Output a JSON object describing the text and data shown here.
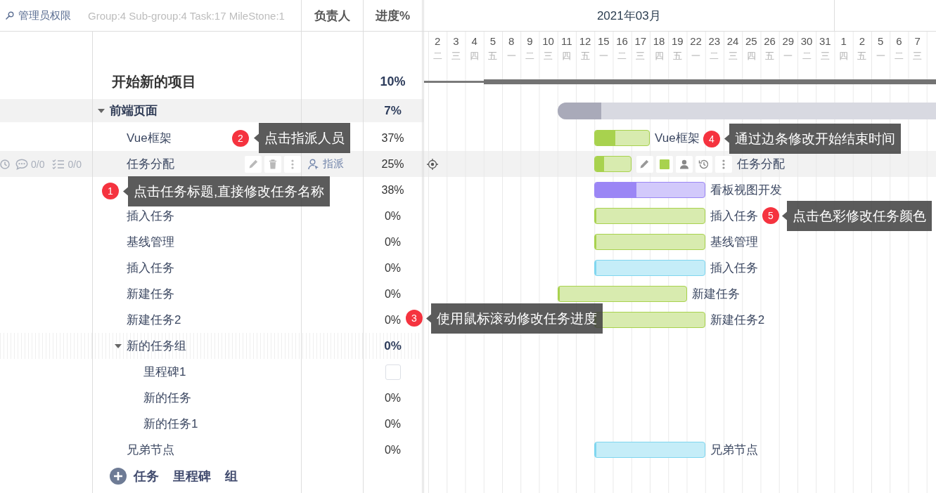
{
  "toolbar": {
    "role_link": "管理员权限",
    "summary": "Group:4 Sub-group:4 Task:17 MileStone:1"
  },
  "columns": [
    {
      "label": "负责人"
    },
    {
      "label": "进度%"
    }
  ],
  "timeline": {
    "months": [
      {
        "label": "2021年03月",
        "days": [
          {
            "day": "2",
            "weekday": "二"
          },
          {
            "day": "3",
            "weekday": "三"
          },
          {
            "day": "4",
            "weekday": "四"
          },
          {
            "day": "5",
            "weekday": "五"
          },
          {
            "day": "8",
            "weekday": "一"
          },
          {
            "day": "9",
            "weekday": "二"
          },
          {
            "day": "10",
            "weekday": "三"
          },
          {
            "day": "11",
            "weekday": "四"
          },
          {
            "day": "12",
            "weekday": "五"
          },
          {
            "day": "15",
            "weekday": "一"
          },
          {
            "day": "16",
            "weekday": "二"
          },
          {
            "day": "17",
            "weekday": "三"
          },
          {
            "day": "18",
            "weekday": "四"
          },
          {
            "day": "19",
            "weekday": "五"
          },
          {
            "day": "22",
            "weekday": "一"
          },
          {
            "day": "23",
            "weekday": "二"
          },
          {
            "day": "24",
            "weekday": "三"
          },
          {
            "day": "25",
            "weekday": "四"
          },
          {
            "day": "26",
            "weekday": "五"
          },
          {
            "day": "29",
            "weekday": "一"
          },
          {
            "day": "30",
            "weekday": "二"
          },
          {
            "day": "31",
            "weekday": "三"
          }
        ]
      },
      {
        "days": [
          {
            "day": "1",
            "weekday": "四"
          },
          {
            "day": "2",
            "weekday": "五"
          },
          {
            "day": "5",
            "weekday": "一"
          },
          {
            "day": "6",
            "weekday": "二"
          },
          {
            "day": "7",
            "weekday": "三"
          }
        ]
      }
    ]
  },
  "tasks": [
    {
      "kind": "project",
      "name": "开始新的项目",
      "progress": "10%",
      "hovered": false,
      "children": [
        {
          "kind": "group",
          "name": "前端页面",
          "progress": "7%",
          "expanded": true,
          "hovered": false,
          "bar": {
            "level": 0.07
          },
          "children": [
            {
              "kind": "task",
              "name": "Vue框架",
              "progress": "37%",
              "hovered": false,
              "bar": {
                "level": 0.37,
                "color": "#a8d24e",
                "label": "Vue框架"
              }
            },
            {
              "kind": "task",
              "name": "任务分配",
              "progress": "25%",
              "hovered": true,
              "comments": "0/0",
              "checklist": "0/0",
              "assign_action": "指派",
              "bar": {
                "level": 0.25,
                "color": "#a8d24e",
                "label": "任务分配"
              }
            },
            {
              "kind": "task",
              "progress": "38%",
              "hovered": false,
              "bar": {
                "level": 0.38,
                "color": "#9b86f5",
                "label": "看板视图开发"
              }
            },
            {
              "kind": "task",
              "name": "插入任务",
              "progress": "0%",
              "hovered": false,
              "bar": {
                "level": 0,
                "color": "#a8d24e",
                "label": "插入任务"
              }
            },
            {
              "kind": "task",
              "name": "基线管理",
              "progress": "0%",
              "hovered": false,
              "bar": {
                "level": 0,
                "color": "#a8d24e",
                "label": "基线管理"
              }
            },
            {
              "kind": "task",
              "name": "插入任务",
              "progress": "0%",
              "hovered": false,
              "bar": {
                "level": 0,
                "color": "#7fd6ef",
                "label": "插入任务"
              }
            },
            {
              "kind": "task",
              "name": "新建任务",
              "progress": "0%",
              "hovered": false,
              "bar": {
                "level": 0,
                "color": "#a8d24e",
                "label": "新建任务"
              }
            },
            {
              "kind": "task",
              "name": "新建任务2",
              "progress": "0%",
              "hovered": false,
              "bar": {
                "level": 0,
                "color": "#a8d24e",
                "label": "新建任务2"
              }
            },
            {
              "kind": "group",
              "name": "新的任务组",
              "progress": "0%",
              "expanded": true,
              "hovered": false,
              "children": [
                {
                  "kind": "milestone",
                  "name": "里程碑1",
                  "checked": false,
                  "hovered": false
                },
                {
                  "kind": "task",
                  "name": "新的任务",
                  "progress": "0%",
                  "hovered": false
                },
                {
                  "kind": "task",
                  "name": "新的任务1",
                  "progress": "0%",
                  "hovered": false
                }
              ]
            },
            {
              "kind": "task",
              "name": "兄弟节点",
              "progress": "0%",
              "hovered": false,
              "bar": {
                "level": 0,
                "color": "#7fd6ef",
                "label": "兄弟节点"
              }
            }
          ]
        }
      ]
    }
  ],
  "add_actions": [
    "任务",
    "里程碑",
    "组"
  ],
  "guide_steps": [
    {
      "number": "2",
      "text": "点击指派人员"
    },
    {
      "number": "4",
      "text": "通过边条修改开始结束时间"
    },
    {
      "number": "1",
      "text": "点击任务标题,直接修改任务名称"
    },
    {
      "number": "5",
      "text": "点击色彩修改任务颜色"
    },
    {
      "number": "3",
      "text": "使用鼠标滚动修改任务进度"
    }
  ]
}
